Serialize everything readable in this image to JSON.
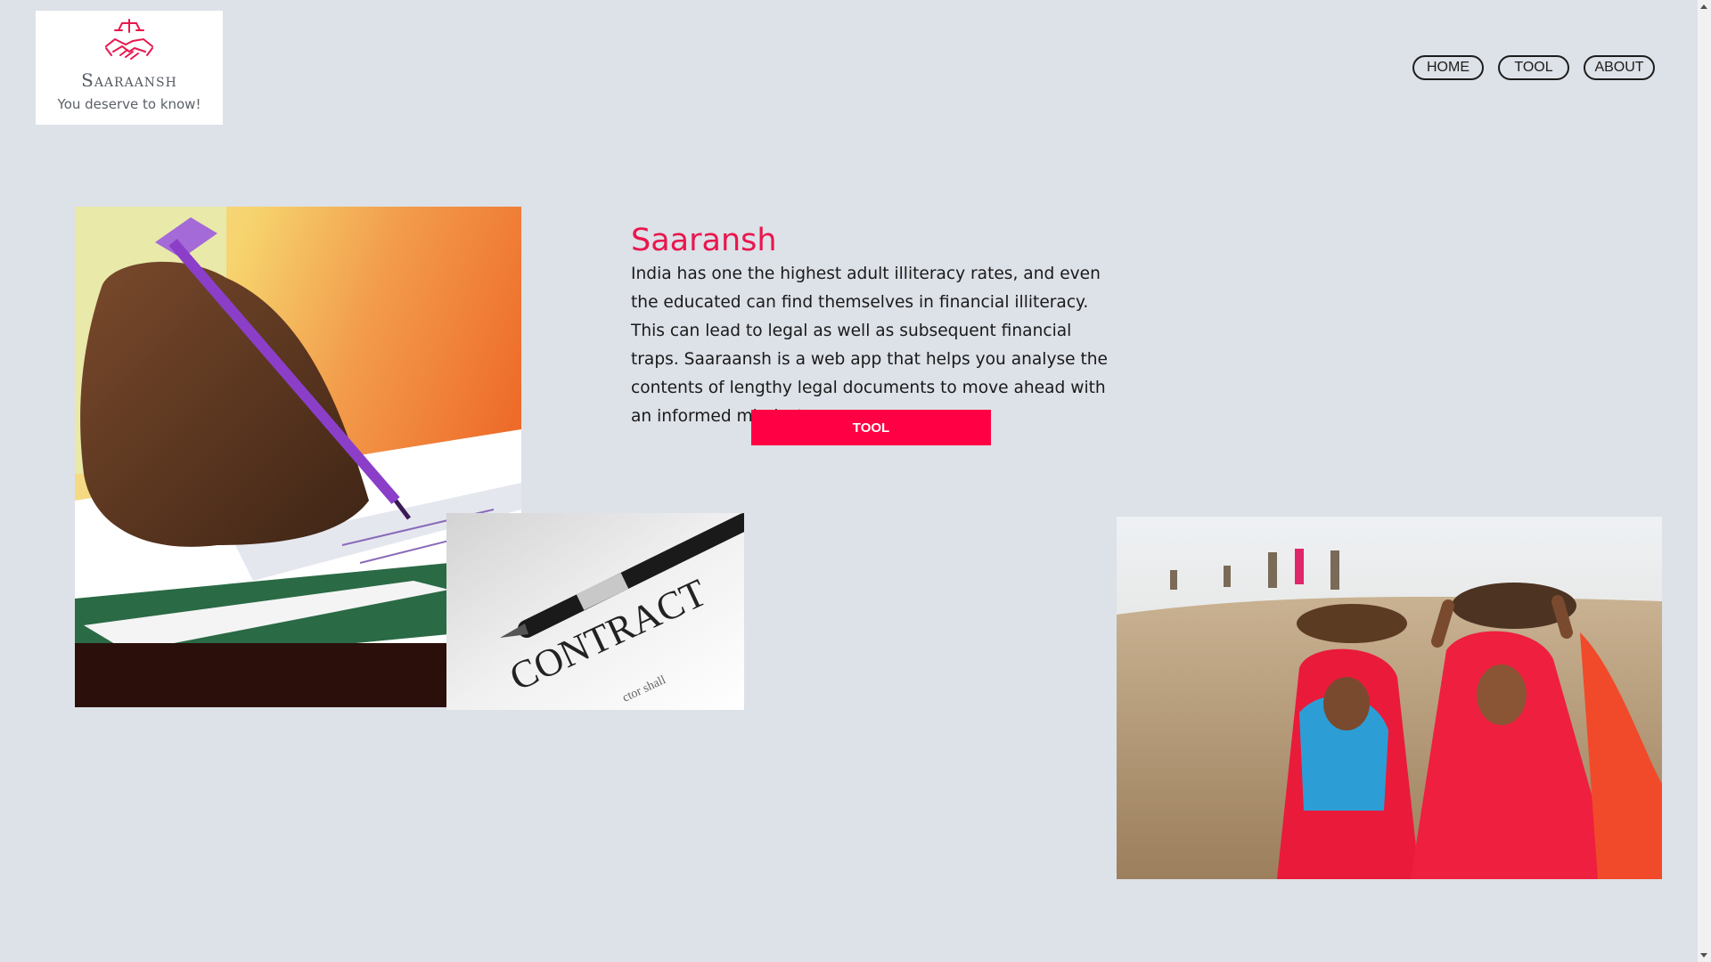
{
  "brand": {
    "name": "Saaraansh",
    "tagline": "You deserve to know!",
    "logo_icon": "handshake-with-scales-icon",
    "logo_color": "#e8174d"
  },
  "nav": {
    "items": [
      {
        "label": "HOME"
      },
      {
        "label": "TOOL"
      },
      {
        "label": "ABOUT"
      }
    ]
  },
  "hero": {
    "title": "Saaransh",
    "description": "India has one the highest adult illiteracy rates, and even the educated can find themselves in financial illiteracy. This can lead to legal as well as subsequent financial traps. Saaraansh is a web app that helps you analyse the contents of lengthy legal documents to move ahead with an informed mindset.",
    "cta_label": "TOOL",
    "accent_color": "#ff0044"
  },
  "images": {
    "writing_hand": "hand-writing-with-pen-photo",
    "contract_pen": "contract-document-with-pen-photo",
    "contract_word": "CONTRACT",
    "women_carrying_bowls": "women-carrying-bowls-photo"
  }
}
